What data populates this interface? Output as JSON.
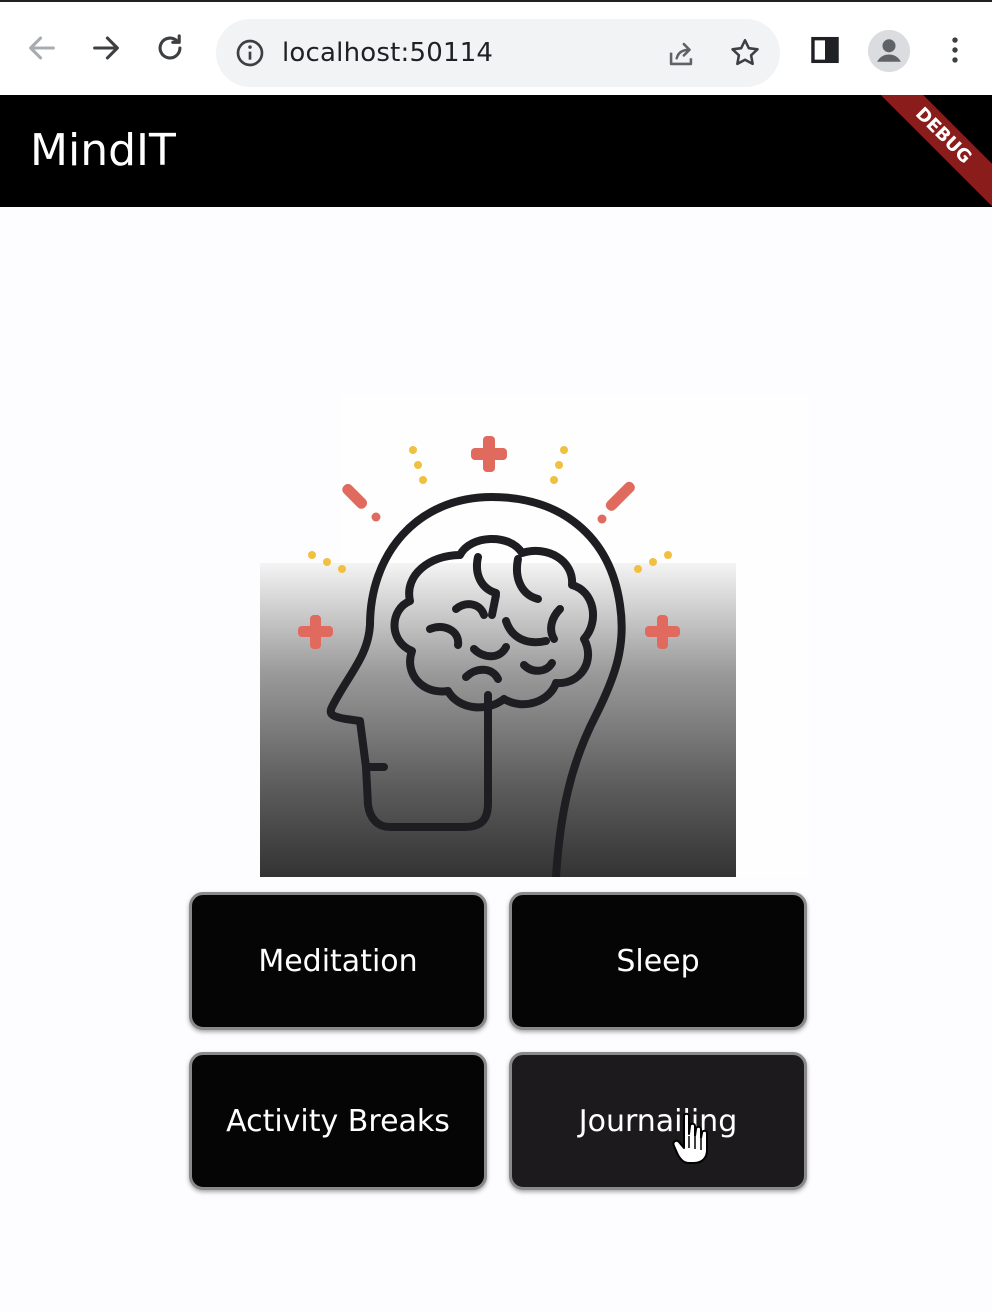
{
  "browser": {
    "url": "localhost:50114"
  },
  "app": {
    "title": "MindIT",
    "debug_banner": "DEBUG"
  },
  "illustration": {
    "icon": "head-brain-icon",
    "colors": {
      "outline": "#1e1d22",
      "plus": "#e06a5e",
      "dots": "#f0c040"
    }
  },
  "tiles": [
    {
      "label": "Meditation"
    },
    {
      "label": "Sleep"
    },
    {
      "label": "Activity Breaks"
    },
    {
      "label": "Journailing"
    }
  ],
  "colors": {
    "app_bar": "#000000",
    "tile_bg": "#050505",
    "tile_border": "#8a8a8a",
    "debug": "#8b1c1c"
  }
}
